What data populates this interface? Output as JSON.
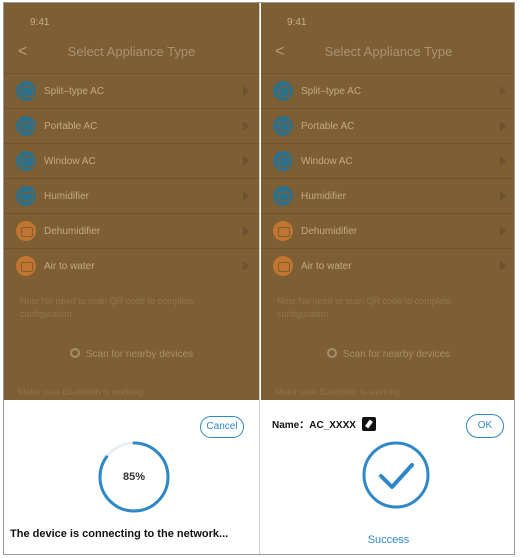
{
  "screens": [
    {
      "status_time": "9:41",
      "title": "Select Appliance Type",
      "items": [
        {
          "label": "Split–type AC",
          "icon": "split-ac-icon",
          "color": "#2f6f87"
        },
        {
          "label": "Portable AC",
          "icon": "portable-ac-icon",
          "color": "#2f6f87"
        },
        {
          "label": "Window AC",
          "icon": "window-ac-icon",
          "color": "#2f6f87"
        },
        {
          "label": "Humidifier",
          "icon": "humidifier-icon",
          "color": "#2f6f87"
        },
        {
          "label": "Dehumidifier",
          "icon": "dehumidifier-icon",
          "color": "#c27530"
        },
        {
          "label": "Air to water",
          "icon": "air-to-water-icon",
          "color": "#c27530"
        }
      ],
      "note": "Note:No need to scan QR code to complete configuration",
      "scan_label": "Scan for nearby devices",
      "hint": "Make sure Bluetooth is working"
    },
    {
      "status_time": "9:41",
      "title": "Select Appliance Type",
      "items": [
        {
          "label": "Split–type AC",
          "icon": "split-ac-icon",
          "color": "#2f6f87"
        },
        {
          "label": "Portable AC",
          "icon": "portable-ac-icon",
          "color": "#2f6f87"
        },
        {
          "label": "Window AC",
          "icon": "window-ac-icon",
          "color": "#2f6f87"
        },
        {
          "label": "Humidifier",
          "icon": "humidifier-icon",
          "color": "#2f6f87"
        },
        {
          "label": "Dehumidifier",
          "icon": "dehumidifier-icon",
          "color": "#c27530"
        },
        {
          "label": "Air to water",
          "icon": "air-to-water-icon",
          "color": "#c27530"
        }
      ],
      "note": "Note:No need to scan QR code to complete configuration",
      "scan_label": "Scan for nearby devices",
      "hint": "Make sure Bluetooth is working"
    }
  ],
  "connecting_sheet": {
    "cancel_label": "Cancel",
    "progress_text": "85%",
    "progress_value": 0.85,
    "message": "The device is connecting to the network..."
  },
  "success_sheet": {
    "name_label": "Name：AC_XXXX",
    "ok_label": "OK",
    "success_label": "Success"
  },
  "colors": {
    "accent": "#2e87c6",
    "overlay": "#7d5f33"
  }
}
